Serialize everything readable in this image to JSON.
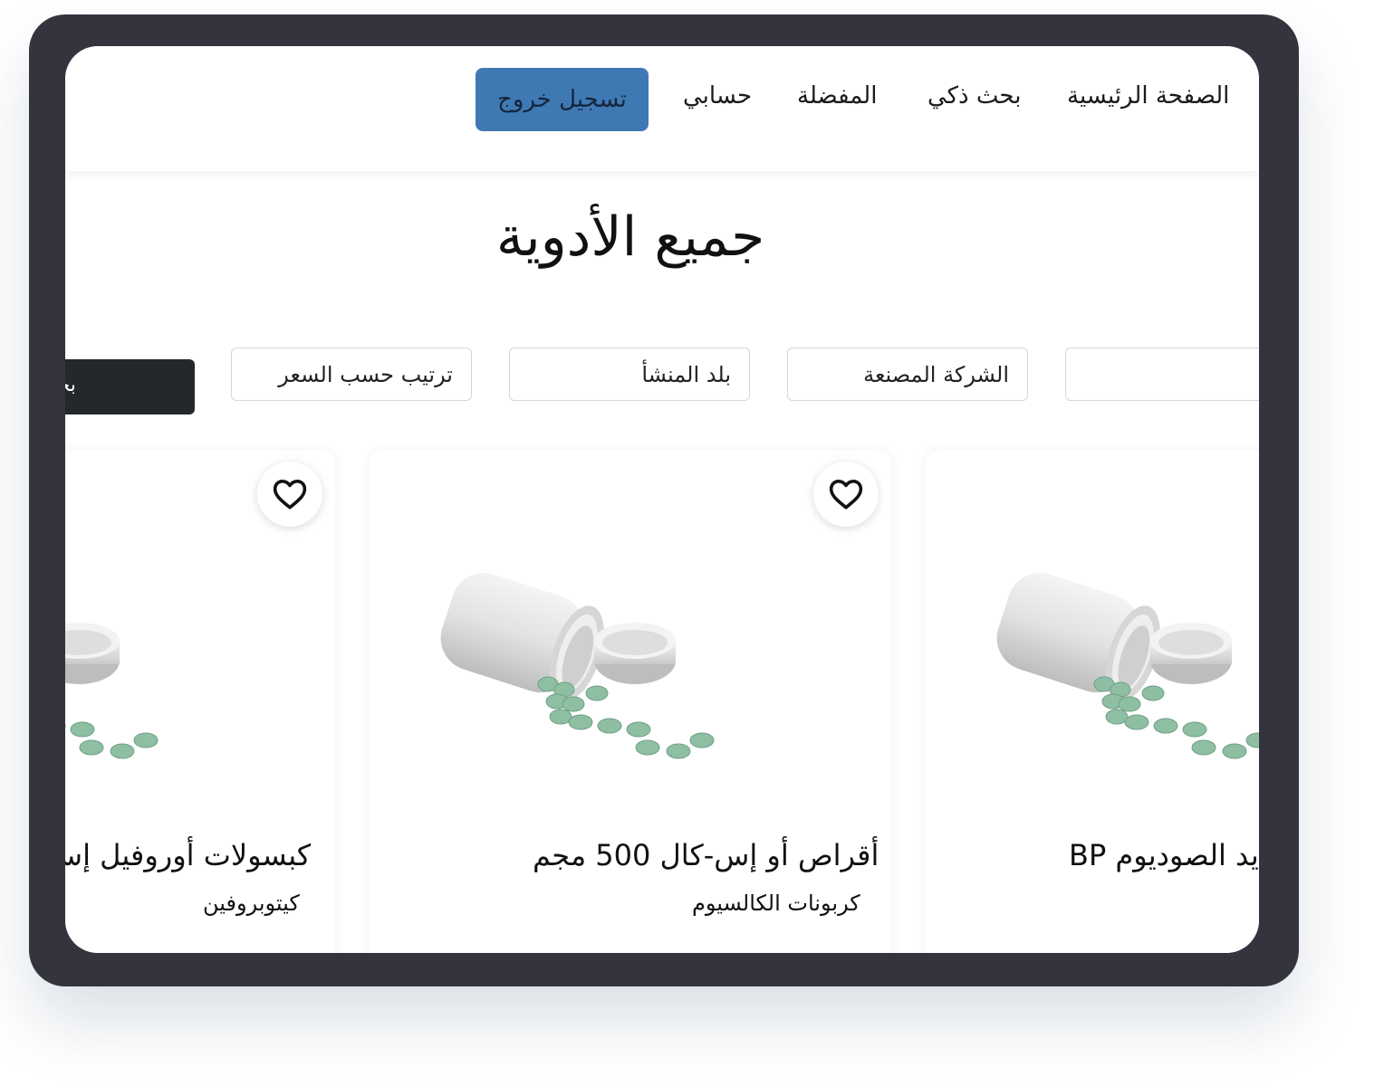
{
  "nav": {
    "home": "الصفحة الرئيسية",
    "smart_search": "بحث ذكي",
    "favorites": "المفضلة",
    "account": "حسابي",
    "logout": "تسجيل خروج"
  },
  "page_title": "جميع الأدوية",
  "filters": {
    "search_value": "",
    "manufacturer": "الشركة المصنعة",
    "origin_country": "بلد المنشأ",
    "sort_price": "ترتيب حسب السعر",
    "search_button": "بحث"
  },
  "cards": [
    {
      "name": "يد الصوديوم BP",
      "generic": ""
    },
    {
      "name": "أقراص أو إس-كال 500 مجم",
      "generic": "كربونات الكالسيوم"
    },
    {
      "name": "كبسولات أوروفيل إس",
      "generic": "كيتوبروفين"
    }
  ],
  "icons": {
    "favorite": "heart-outline-icon",
    "product": "pill-bottle-image"
  },
  "colors": {
    "frame": "#34343f",
    "logout_button": "#3f79b4",
    "search_button": "#24272b",
    "pills": "#8fbfa3"
  }
}
